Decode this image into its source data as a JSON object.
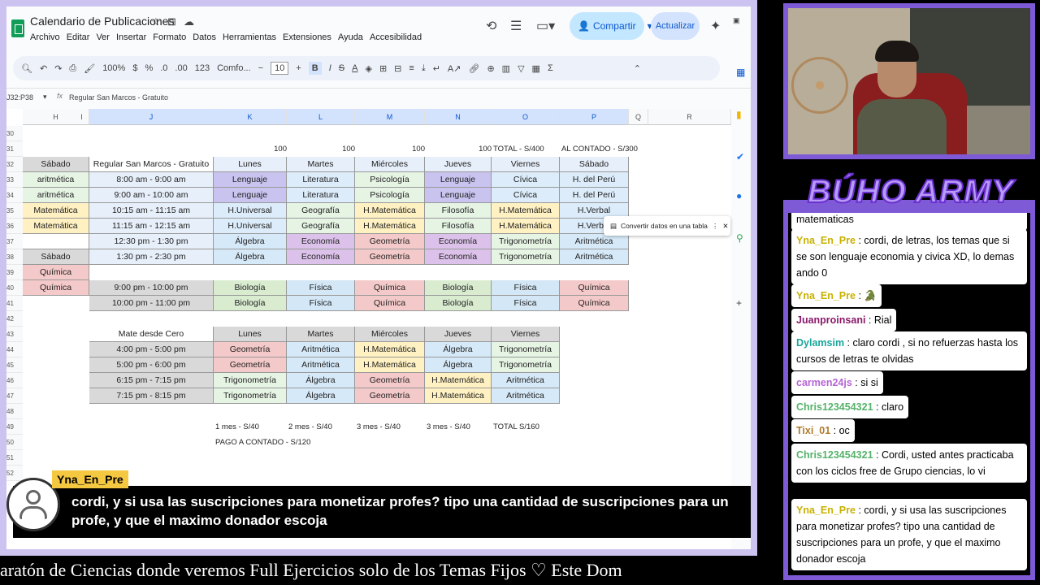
{
  "sheet": {
    "title": "Calendario de Publicaciones",
    "menu": [
      "Archivo",
      "Editar",
      "Ver",
      "Insertar",
      "Formato",
      "Datos",
      "Herramientas",
      "Extensiones",
      "Ayuda",
      "Accesibilidad"
    ],
    "share_label": "Compartir",
    "update_label": "Actualizar",
    "zoom": "100%",
    "font": "Comfo...",
    "font_size": "10",
    "namebox": "J32:P38",
    "formula_value": "Regular San Marcos - Gratuito",
    "convert_chip": "Convertir datos en una tabla",
    "columns": [
      "H",
      "I",
      "J",
      "K",
      "L",
      "M",
      "N",
      "O",
      "P",
      "Q",
      "R"
    ],
    "rows": [
      "30",
      "31",
      "32",
      "33",
      "34",
      "35",
      "36",
      "37",
      "38",
      "39",
      "40",
      "41",
      "42",
      "43",
      "44",
      "45",
      "46",
      "47",
      "48",
      "49",
      "50",
      "51",
      "52"
    ],
    "row31": [
      "100",
      "100",
      "100",
      "100",
      "TOTAL - S/400",
      "AL CONTADO - S/300"
    ],
    "h_col": [
      "Sábado",
      "aritmética",
      "aritmética",
      "Matemática",
      "Matemática",
      "",
      "Sábado",
      "Química",
      "Química"
    ],
    "block1": {
      "header": [
        "Regular San Marcos - Gratuito",
        "Lunes",
        "Martes",
        "Miércoles",
        "Jueves",
        "Viernes",
        "Sábado"
      ],
      "rows": [
        [
          "8:00 am - 9:00 am",
          "Lenguaje",
          "Literatura",
          "Psicología",
          "Lenguaje",
          "Cívica",
          "H. del Perú"
        ],
        [
          "9:00 am - 10:00 am",
          "Lenguaje",
          "Literatura",
          "Psicología",
          "Lenguaje",
          "Cívica",
          "H. del Perú"
        ],
        [
          "10:15 am - 11:15 am",
          "H.Universal",
          "Geografía",
          "H.Matemática",
          "Filosofía",
          "H.Matemática",
          "H.Verbal"
        ],
        [
          "11:15 am - 12:15 am",
          "H.Universal",
          "Geografía",
          "H.Matemática",
          "Filosofía",
          "H.Matemática",
          "H.Verbal"
        ],
        [
          "12:30 pm - 1:30 pm",
          "Álgebra",
          "Economía",
          "Geometría",
          "Economía",
          "Trigonometría",
          "Aritmética"
        ],
        [
          "1:30 pm - 2:30 pm",
          "Álgebra",
          "Economía",
          "Geometría",
          "Economía",
          "Trigonometría",
          "Aritmética"
        ]
      ]
    },
    "block2": {
      "rows": [
        [
          "9:00 pm - 10:00 pm",
          "Biología",
          "Física",
          "Química",
          "Biología",
          "Física",
          "Química"
        ],
        [
          "10:00 pm - 11:00 pm",
          "Biología",
          "Física",
          "Química",
          "Biología",
          "Física",
          "Química"
        ]
      ]
    },
    "block3": {
      "header": [
        "Mate desde Cero",
        "Lunes",
        "Martes",
        "Miércoles",
        "Jueves",
        "Viernes"
      ],
      "rows": [
        [
          "4:00 pm - 5:00 pm",
          "Geometría",
          "Aritmética",
          "H.Matemática",
          "Álgebra",
          "Trigonometría"
        ],
        [
          "5:00 pm - 6:00 pm",
          "Geometría",
          "Aritmética",
          "H.Matemática",
          "Álgebra",
          "Trigonometría"
        ],
        [
          "6:15 pm - 7:15 pm",
          "Trigonometría",
          "Álgebra",
          "Geometría",
          "H.Matemática",
          "Aritmética"
        ],
        [
          "7:15 pm - 8:15 pm",
          "Trigonometría",
          "Álgebra",
          "Geometría",
          "H.Matemática",
          "Aritmética"
        ]
      ]
    },
    "row49": [
      "1 mes - S/40",
      "2 mes - S/40",
      "3 mes - S/40",
      "3 mes - S/40",
      "TOTAL S/160"
    ],
    "row50": "PAGO A CONTADO - S/120"
  },
  "overlay": {
    "name": "Yna_En_Pre",
    "text": "cordi, y si usa las suscripciones para monetizar profes? tipo una cantidad de suscripciones para un profe, y que el maximo donador escoja"
  },
  "ticker": "aratón de Ciencias donde veremos Full Ejercicios solo de los Temas Fijos        ♡        Este Dom",
  "brand": "BÚHO ARMY",
  "chat": [
    {
      "user": "",
      "text": "matematicas",
      "color": "#000000"
    },
    {
      "user": "Yna_En_Pre",
      "text": ": cordi, de letras, los temas que si se son lenguaje economia y civica XD, lo demas ando 0",
      "color": "#c9b100"
    },
    {
      "user": "Yna_En_Pre",
      "text": ": 🐊",
      "color": "#c9b100"
    },
    {
      "user": "Juanproinsani",
      "text": ": Rial",
      "color": "#8b1a6b"
    },
    {
      "user": "Dylamsim",
      "text": ": claro cordi , si no refuerzas hasta los cursos de letras te olvidas",
      "color": "#1aa69a"
    },
    {
      "user": "carmen24js",
      "text": ": si si",
      "color": "#b565d6"
    },
    {
      "user": "Chris123454321",
      "text": ": claro",
      "color": "#55b26a"
    },
    {
      "user": "Tixi_01",
      "text": ": oc",
      "color": "#b07b2a"
    },
    {
      "user": "Chris123454321",
      "text": ": Cordi, usted antes practicaba con los ciclos free de Grupo ciencias, lo vi",
      "color": "#55b26a"
    },
    {
      "user": "Yna_En_Pre",
      "text": ": cordi, y si usa las suscripciones para monetizar profes? tipo una cantidad de suscripciones para un profe, y que el maximo donador escoja",
      "color": "#c9b100"
    }
  ],
  "colors": {
    "purple_frame": "#7f5ad6",
    "lenguaje": "#c9c3ef",
    "literatura": "#dcecfa",
    "psicologia": "#e6f4e4",
    "civica": "#dcecfa",
    "peru": "#dcecfa",
    "hmat": "#fff1c2",
    "economia": "#dcc2ea",
    "algebra": "#d6e9f8",
    "geometria": "#f4c9c9",
    "biologia": "#d9ecd0",
    "fisica": "#d3e7f6",
    "quimica": "#f4c9c9",
    "gray": "#d9d9d9",
    "sel": "#e7effa"
  }
}
